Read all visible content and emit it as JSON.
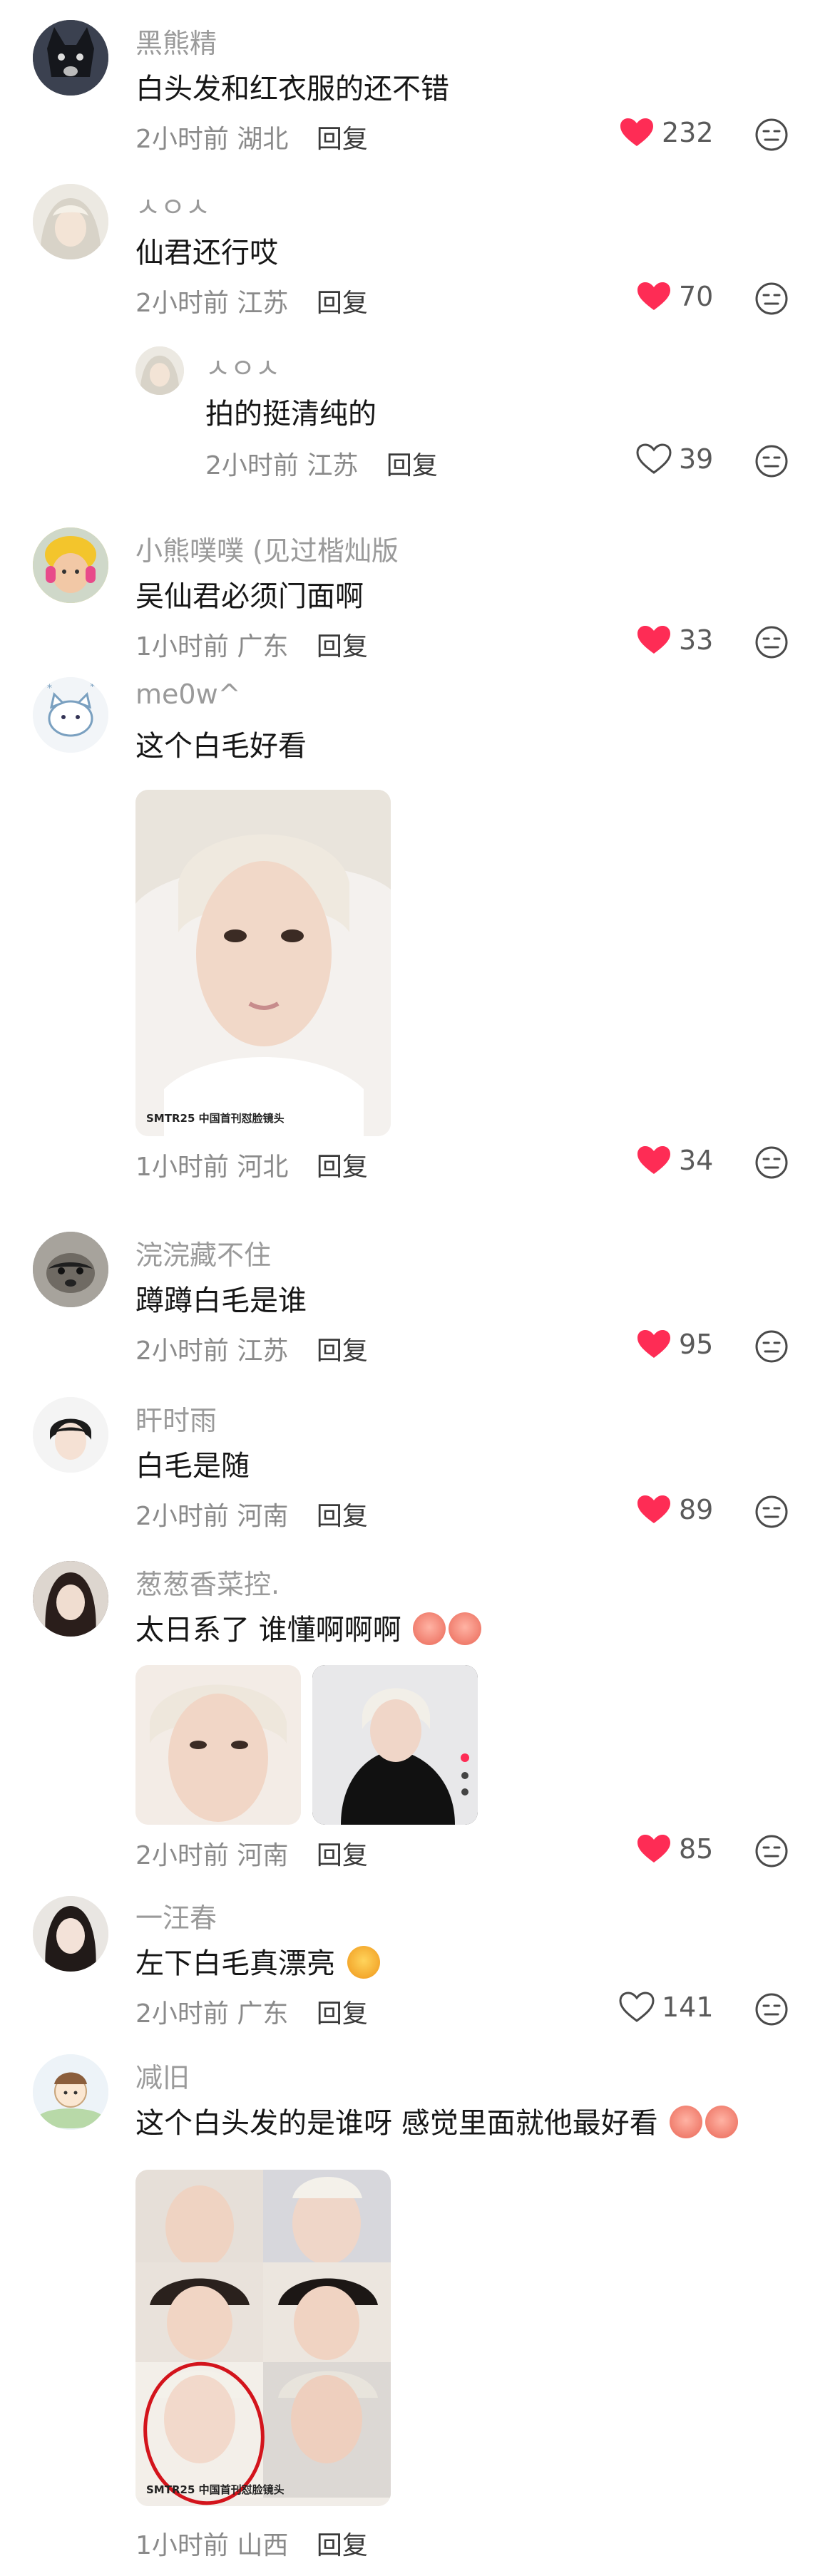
{
  "comments": [
    {
      "user": "黑熊精",
      "text": "白头发和红衣服的还不错",
      "time": "2小时前",
      "loc": "湖北",
      "reply": "回复",
      "likes": "232",
      "liked": true
    },
    {
      "user": "ㅅㅇㅅ",
      "text": "仙君还行哎",
      "time": "2小时前",
      "loc": "江苏",
      "reply": "回复",
      "likes": "70",
      "liked": true
    },
    {
      "user": "ㅅㅇㅅ",
      "text": "拍的挺清纯的",
      "time": "2小时前",
      "loc": "江苏",
      "reply": "回复",
      "likes": "39",
      "liked": false
    },
    {
      "user": "小熊噗噗 (见过楷灿版",
      "text": "吴仙君必须门面啊",
      "time": "1小时前",
      "loc": "广东",
      "reply": "回复",
      "likes": "33",
      "liked": true
    },
    {
      "user": "me0w^",
      "text": "这个白毛好看",
      "caption": "SMTR25 中国首刊怼脸镜头",
      "time": "1小时前",
      "loc": "河北",
      "reply": "回复",
      "likes": "34",
      "liked": true
    },
    {
      "user": "浣浣藏不住",
      "text": "蹲蹲白毛是谁",
      "time": "2小时前",
      "loc": "江苏",
      "reply": "回复",
      "likes": "95",
      "liked": true
    },
    {
      "user": "盰时雨",
      "text": "白毛是随",
      "time": "2小时前",
      "loc": "河南",
      "reply": "回复",
      "likes": "89",
      "liked": true
    },
    {
      "user": "葱葱香菜控.",
      "text": "太日系了 谁懂啊啊啊",
      "time": "2小时前",
      "loc": "河南",
      "reply": "回复",
      "likes": "85",
      "liked": true
    },
    {
      "user": "一汪春",
      "text": "左下白毛真漂亮",
      "time": "2小时前",
      "loc": "广东",
      "reply": "回复",
      "likes": "141",
      "liked": false
    },
    {
      "user": "减旧",
      "text": "这个白头发的是谁呀 感觉里面就他最好看",
      "caption": "SMTR25 中国首刊怼脸镜头",
      "time": "1小时前",
      "loc": "山西",
      "reply": "回复"
    }
  ],
  "colors": {
    "accent": "#fe2c55",
    "username": "#9a9a9a",
    "meta": "#8a8a8a"
  },
  "icons": {
    "like": "heart-icon",
    "dislike": "meh-face-icon"
  }
}
